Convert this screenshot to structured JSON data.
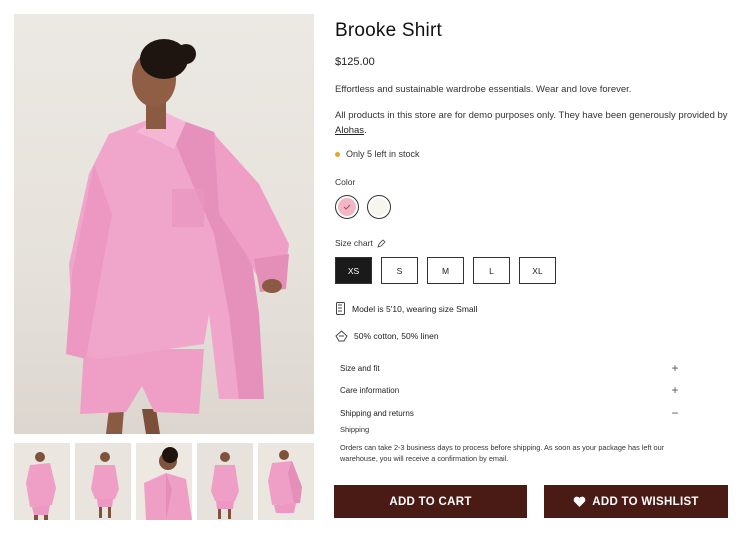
{
  "product": {
    "title": "Brooke Shirt",
    "price": "$125.00",
    "description": "Effortless and sustainable wardrobe essentials. Wear and love forever.",
    "demo_note_prefix": "All products in this store are for demo purposes only. They have been generously provided by ",
    "demo_note_link": "Alohas",
    "demo_note_suffix": ".",
    "stock": "Only 5 left in stock"
  },
  "color": {
    "label": "Color",
    "options": [
      {
        "name": "pink",
        "hex": "#f2b7c4",
        "selected": true
      },
      {
        "name": "white",
        "hex": "#f7f5ee",
        "selected": false
      }
    ]
  },
  "size": {
    "label": "Size chart",
    "options": [
      "XS",
      "S",
      "M",
      "L",
      "XL"
    ],
    "selected": "XS"
  },
  "details": {
    "model": "Model is 5'10, wearing size Small",
    "material": "50% cotton, 50% linen"
  },
  "accordion": {
    "items": [
      {
        "label": "Size and fit",
        "sign": "+"
      },
      {
        "label": "Care information",
        "sign": "+"
      },
      {
        "label": "Shipping and returns",
        "sign": "−"
      }
    ],
    "open_subtitle": "Shipping",
    "open_body": "Orders can take 2-3 business days to process before shipping. As soon as your package has left our warehouse, you will receive a confirmation by email."
  },
  "actions": {
    "add_to_cart": "ADD TO CART",
    "add_to_wishlist": "ADD TO WISHLIST"
  },
  "colors": {
    "button_bg": "#4a1a14",
    "stock_dot": "#e9a52a",
    "shirt_pink": "#ef9fc6"
  },
  "thumbnails": [
    "thumbnail-1",
    "thumbnail-2",
    "thumbnail-3",
    "thumbnail-4",
    "thumbnail-5"
  ]
}
